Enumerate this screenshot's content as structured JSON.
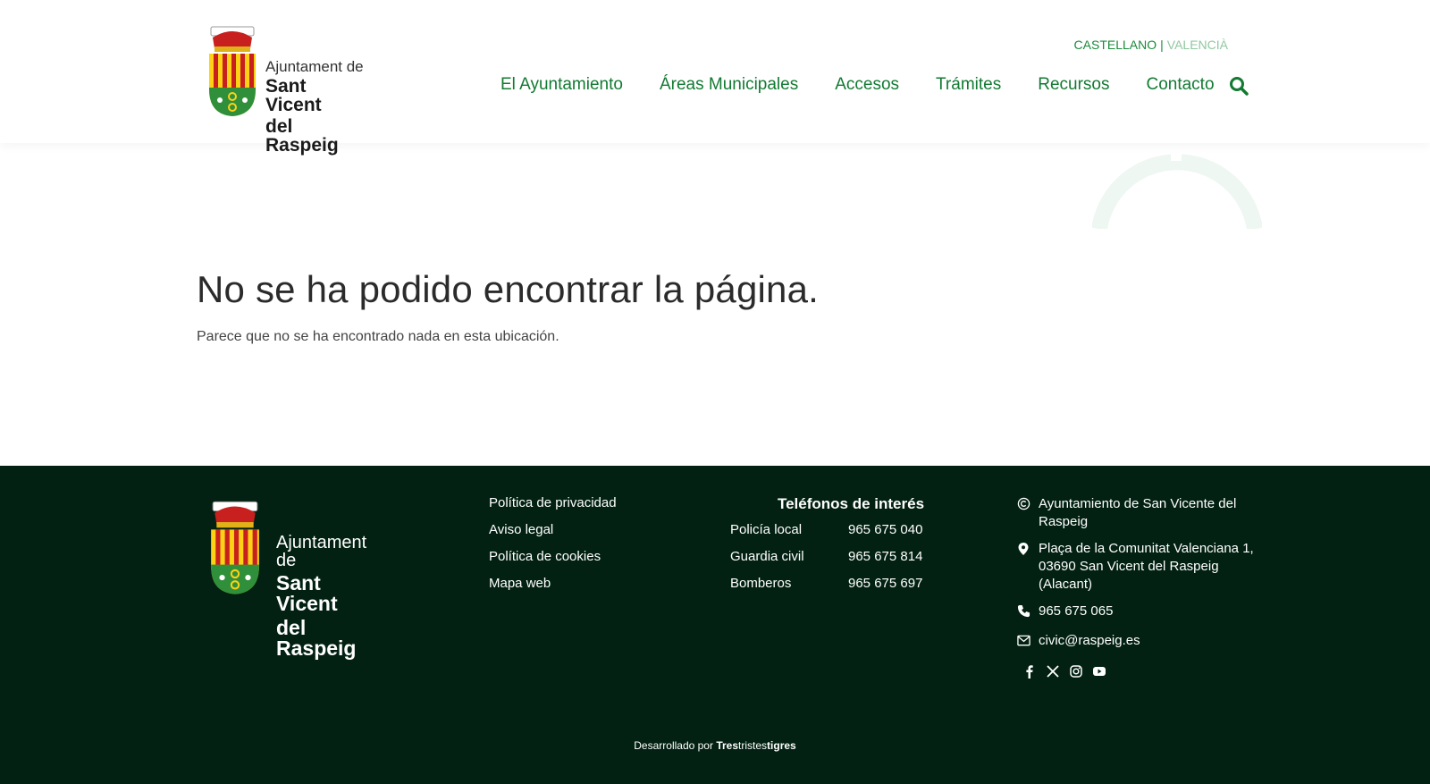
{
  "header": {
    "logo": {
      "line1": "Ajuntament de",
      "line2": "Sant Vicent",
      "line3": "del Raspeig"
    },
    "lang": {
      "es": "CASTELLANO",
      "separator": "|",
      "va": "VALENCIÀ"
    },
    "nav": [
      "El Ayuntamiento",
      "Áreas Municipales",
      "Accesos",
      "Trámites",
      "Recursos",
      "Contacto"
    ],
    "search_icon": "search-icon"
  },
  "main": {
    "title": "No se ha podido encontrar la página.",
    "subtitle": "Parece que no se ha encontrado nada en esta ubicación."
  },
  "footer": {
    "logo": {
      "line1": "Ajuntament de",
      "line2": "Sant Vicent",
      "line3": "del Raspeig"
    },
    "legal_links": [
      "Política de privacidad",
      "Aviso legal",
      "Política de cookies",
      "Mapa web"
    ],
    "phones_title": "Teléfonos de interés",
    "phones": [
      {
        "name": "Policía local",
        "number": "965 675 040"
      },
      {
        "name": "Guardia civil",
        "number": "965 675 814"
      },
      {
        "name": "Bomberos",
        "number": "965 675 697"
      }
    ],
    "contact": {
      "copyright": "Ayuntamiento de San Vicente del Raspeig",
      "address": "Plaça de la Comunitat Valenciana 1, 03690 San Vicent del Raspeig (Alacant)",
      "phone": "965 675 065",
      "email": "civic@raspeig.es"
    },
    "social_icons": [
      "facebook-icon",
      "x-icon",
      "instagram-icon",
      "youtube-icon"
    ],
    "credit": {
      "prefix": "Desarrollado por",
      "brand_a": "Tres",
      "brand_b": "tristes",
      "brand_c": "tigres"
    }
  },
  "colors": {
    "brand_green": "#127a32",
    "lang_inactive": "#8fc89f",
    "footer_bg": "#022112"
  }
}
